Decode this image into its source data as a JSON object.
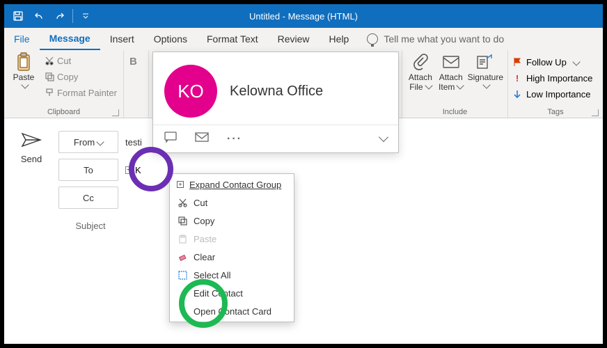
{
  "window": {
    "title": "Untitled  -  Message (HTML)"
  },
  "menubar": {
    "file": "File",
    "message": "Message",
    "insert": "Insert",
    "options": "Options",
    "formattext": "Format Text",
    "review": "Review",
    "help": "Help",
    "tellme": "Tell me what you want to do"
  },
  "ribbon": {
    "paste": "Paste",
    "cut": "Cut",
    "copy": "Copy",
    "formatpainter": "Format Painter",
    "clipboard_label": "Clipboard",
    "bold": "B",
    "attachfile": "Attach",
    "attachfile2": "File",
    "attachitem": "Attach",
    "attachitem2": "Item",
    "signature": "Signature",
    "include_label": "Include",
    "followup": "Follow Up",
    "highimp": "High Importance",
    "lowimp": "Low Importance",
    "tags_label": "Tags"
  },
  "compose": {
    "send": "Send",
    "from": "From",
    "from_value": "testi",
    "to": "To",
    "cc": "Cc",
    "subject": "Subject",
    "to_value": "K"
  },
  "card": {
    "initials": "KO",
    "name": "Kelowna Office"
  },
  "ctx": {
    "expand": "Expand Contact Group",
    "cut": "Cut",
    "copy": "Copy",
    "paste": "Paste",
    "clear": "Clear",
    "selectall": "Select All",
    "edit": "Edit Contact",
    "open": "Open Contact Card"
  }
}
